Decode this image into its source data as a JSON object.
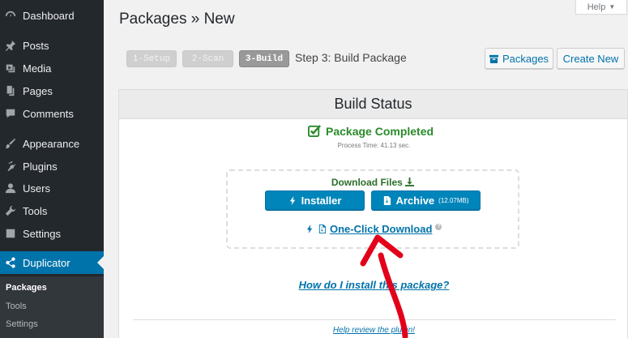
{
  "sidebar": {
    "items": [
      {
        "label": "Dashboard",
        "icon": "dashboard-icon"
      },
      {
        "label": "Posts",
        "icon": "pin-icon"
      },
      {
        "label": "Media",
        "icon": "media-icon"
      },
      {
        "label": "Pages",
        "icon": "page-icon"
      },
      {
        "label": "Comments",
        "icon": "comment-icon"
      },
      {
        "label": "Appearance",
        "icon": "brush-icon"
      },
      {
        "label": "Plugins",
        "icon": "plugin-icon"
      },
      {
        "label": "Users",
        "icon": "user-icon"
      },
      {
        "label": "Tools",
        "icon": "wrench-icon"
      },
      {
        "label": "Settings",
        "icon": "settings-icon"
      },
      {
        "label": "Duplicator",
        "icon": "share-icon"
      }
    ],
    "submenu": [
      "Packages",
      "Tools",
      "Settings"
    ]
  },
  "header": {
    "title": "Packages » New",
    "help_label": "Help",
    "steps": [
      "1-Setup",
      "2-Scan",
      "3-Build"
    ],
    "step_label": "Step 3: Build Package",
    "packages_button": "Packages",
    "create_new_button": "Create New"
  },
  "panel": {
    "title": "Build Status",
    "completed_text": "Package Completed",
    "process_time": "Process Time: 41.13 sec.",
    "download_title": "Download Files",
    "installer_label": "Installer",
    "archive_label": "Archive",
    "archive_size": "(12.07MB)",
    "oneclick_label": "One-Click Download",
    "howto_link": "How do I install this package?",
    "review_link": "Help review the plugin!"
  },
  "colors": {
    "accent": "#0073aa",
    "success": "#2a8b2a",
    "sidebar_bg": "#23282d",
    "annotation_arrow": "#e3001b"
  }
}
